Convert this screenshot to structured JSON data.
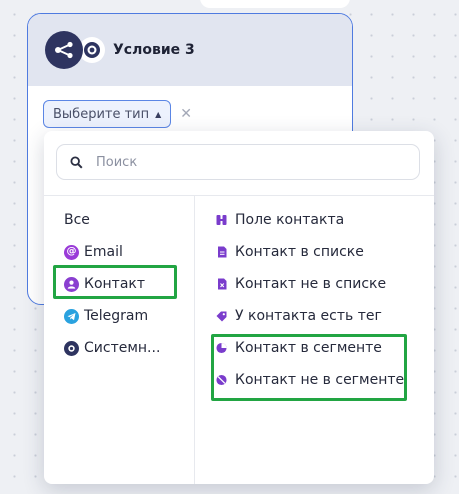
{
  "node": {
    "title": "Условие 3",
    "type_select": {
      "value": "Выберите тип"
    },
    "icons": {
      "main": "share-nodes-icon",
      "badge": "system-target-icon"
    }
  },
  "dropdown": {
    "search": {
      "placeholder": "Поиск"
    },
    "categories": [
      {
        "label": "Все",
        "icon": null
      },
      {
        "label": "Email",
        "icon": "at-sign-icon",
        "color": "#9a3bd8"
      },
      {
        "label": "Контакт",
        "icon": "user-icon",
        "color": "#8a3fd0",
        "selected": true
      },
      {
        "label": "Telegram",
        "icon": "telegram-icon",
        "color": "#2aa2df"
      },
      {
        "label": "Системн...",
        "icon": "system-target-icon",
        "color": "#2e3460"
      }
    ],
    "options": [
      {
        "label": "Поле контакта",
        "icon": "contact-field-icon"
      },
      {
        "label": "Контакт в списке",
        "icon": "list-in-icon"
      },
      {
        "label": "Контакт не в списке",
        "icon": "list-not-in-icon"
      },
      {
        "label": "У контакта есть тег",
        "icon": "tag-icon"
      },
      {
        "label": "Контакт в сегменте",
        "icon": "segment-in-icon"
      },
      {
        "label": "Контакт не в сегменте",
        "icon": "segment-not-in-icon"
      }
    ]
  },
  "colors": {
    "accent": "#8a3fd0",
    "highlight": "#22a543",
    "node_border": "#4f7be0"
  }
}
